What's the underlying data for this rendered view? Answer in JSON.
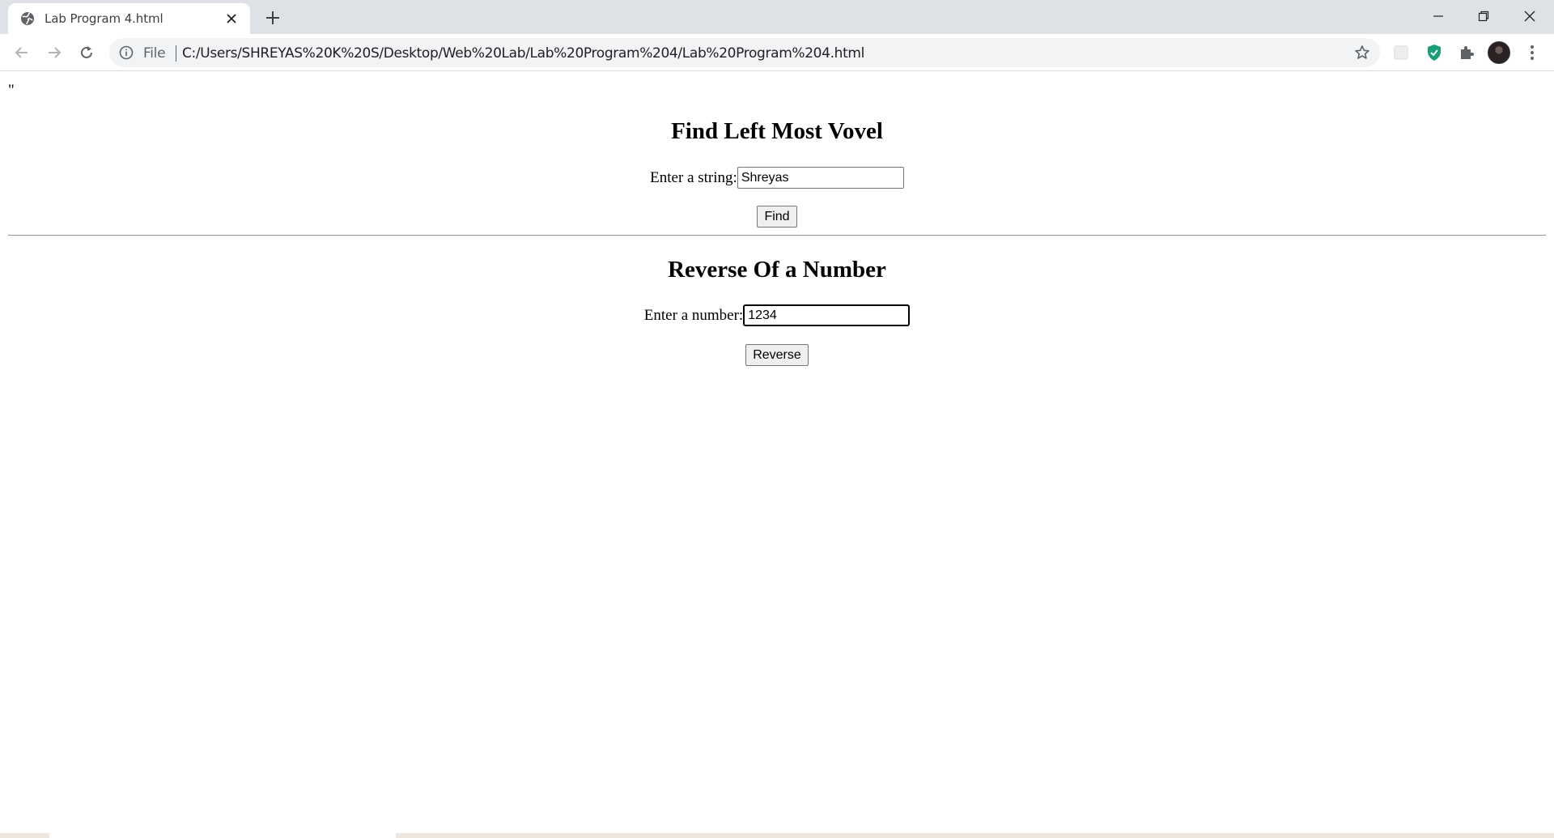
{
  "browser": {
    "tab_title": "Lab Program 4.html",
    "address_scheme_label": "File",
    "address_url": "C:/Users/SHREYAS%20K%20S/Desktop/Web%20Lab/Lab%20Program%204/Lab%20Program%204.html",
    "icons": {
      "favicon": "globe-icon",
      "close_tab": "close-icon",
      "new_tab": "plus-icon",
      "back": "back-arrow-icon",
      "forward": "forward-arrow-icon",
      "reload": "reload-icon",
      "site_info": "info-icon",
      "bookmark": "star-icon",
      "extension_1": "extension-placeholder-icon",
      "extension_2": "shield-check-icon",
      "extensions_menu": "puzzle-icon",
      "profile": "avatar",
      "menu": "kebab-menu-icon",
      "minimize": "minimize-icon",
      "restore": "restore-icon",
      "close_window": "close-window-icon"
    },
    "colors": {
      "tabstrip": "#dee1e6",
      "omnibox": "#f1f3f4",
      "shield": "#1a9e7a"
    }
  },
  "page": {
    "stray_text": "\"",
    "vowel_section": {
      "heading": "Find Left Most Vovel",
      "label": "Enter a string:",
      "input_value": "Shreyas",
      "button_label": "Find"
    },
    "reverse_section": {
      "heading": "Reverse Of a Number",
      "label": "Enter a number:",
      "input_value": "1234",
      "button_label": "Reverse"
    }
  }
}
